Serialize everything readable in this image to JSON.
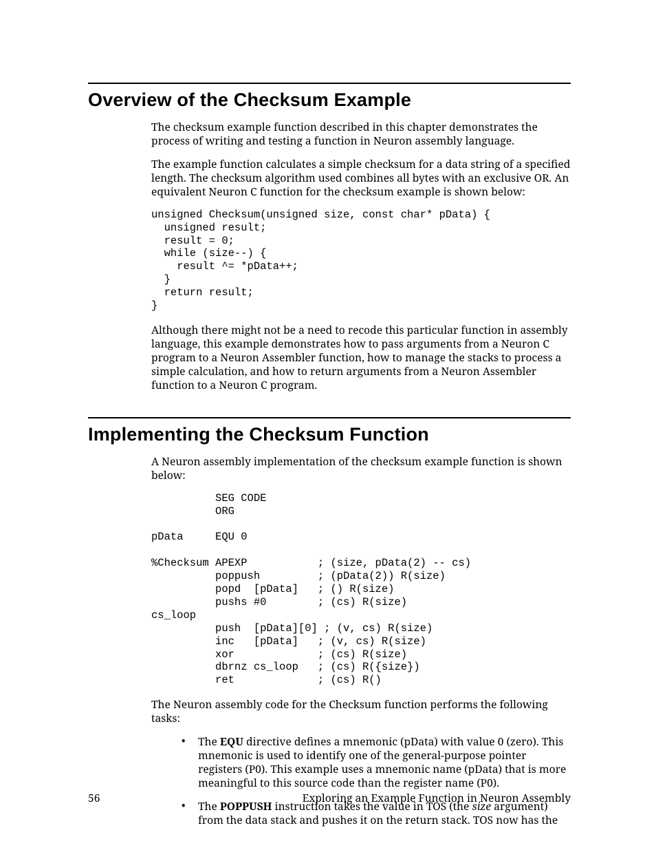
{
  "section1": {
    "title": "Overview of the Checksum Example",
    "p1": "The checksum example function described in this chapter demonstrates the process of writing and testing a function in Neuron assembly language.",
    "p2": "The example function calculates a simple checksum for a data string of a specified length.  The checksum algorithm used combines all bytes with an exclusive OR.  An equivalent Neuron C function for the checksum example is shown below:",
    "code": "unsigned Checksum(unsigned size, const char* pData) {\n  unsigned result;\n  result = 0;\n  while (size--) {\n    result ^= *pData++;\n  }\n  return result;\n}",
    "p3": "Although there might not be a need to recode this particular function in assembly language, this example demonstrates how to pass arguments from a Neuron C program to a Neuron Assembler function, how to manage the stacks to process a simple calculation, and how to return arguments from a Neuron Assembler function to a Neuron C program."
  },
  "section2": {
    "title": "Implementing the Checksum Function",
    "p1": "A Neuron assembly implementation of the checksum example function is shown below:",
    "code": "          SEG CODE\n          ORG\n\npData     EQU 0\n\n%Checksum APEXP           ; (size, pData(2) -- cs)\n          poppush         ; (pData(2)) R(size)\n          popd  [pData]   ; () R(size)\n          pushs #0        ; (cs) R(size)\ncs_loop\n          push  [pData][0] ; (v, cs) R(size)\n          inc   [pData]   ; (v, cs) R(size)\n          xor             ; (cs) R(size)\n          dbrnz cs_loop   ; (cs) R({size})\n          ret             ; (cs) R()",
    "p2": "The Neuron assembly code for the Checksum function performs the following tasks:",
    "bullet1_a": "The ",
    "bullet1_b": "EQU",
    "bullet1_c": " directive defines a mnemonic (pData) with value 0 (zero).  This mnemonic is used to identify one of the general-purpose pointer registers (P0).  This example uses a mnemonic name (pData) that is more meaningful to this source code than the register name (P0).",
    "bullet2_a": "The ",
    "bullet2_b": "POPPUSH",
    "bullet2_c": " instruction takes the value in TOS (the ",
    "bullet2_d": "size",
    "bullet2_e": " argument) from the data stack and pushes it on the return stack.  TOS now has the"
  },
  "footer": {
    "page": "56",
    "chapter": "Exploring an Example Function in Neuron Assembly"
  }
}
